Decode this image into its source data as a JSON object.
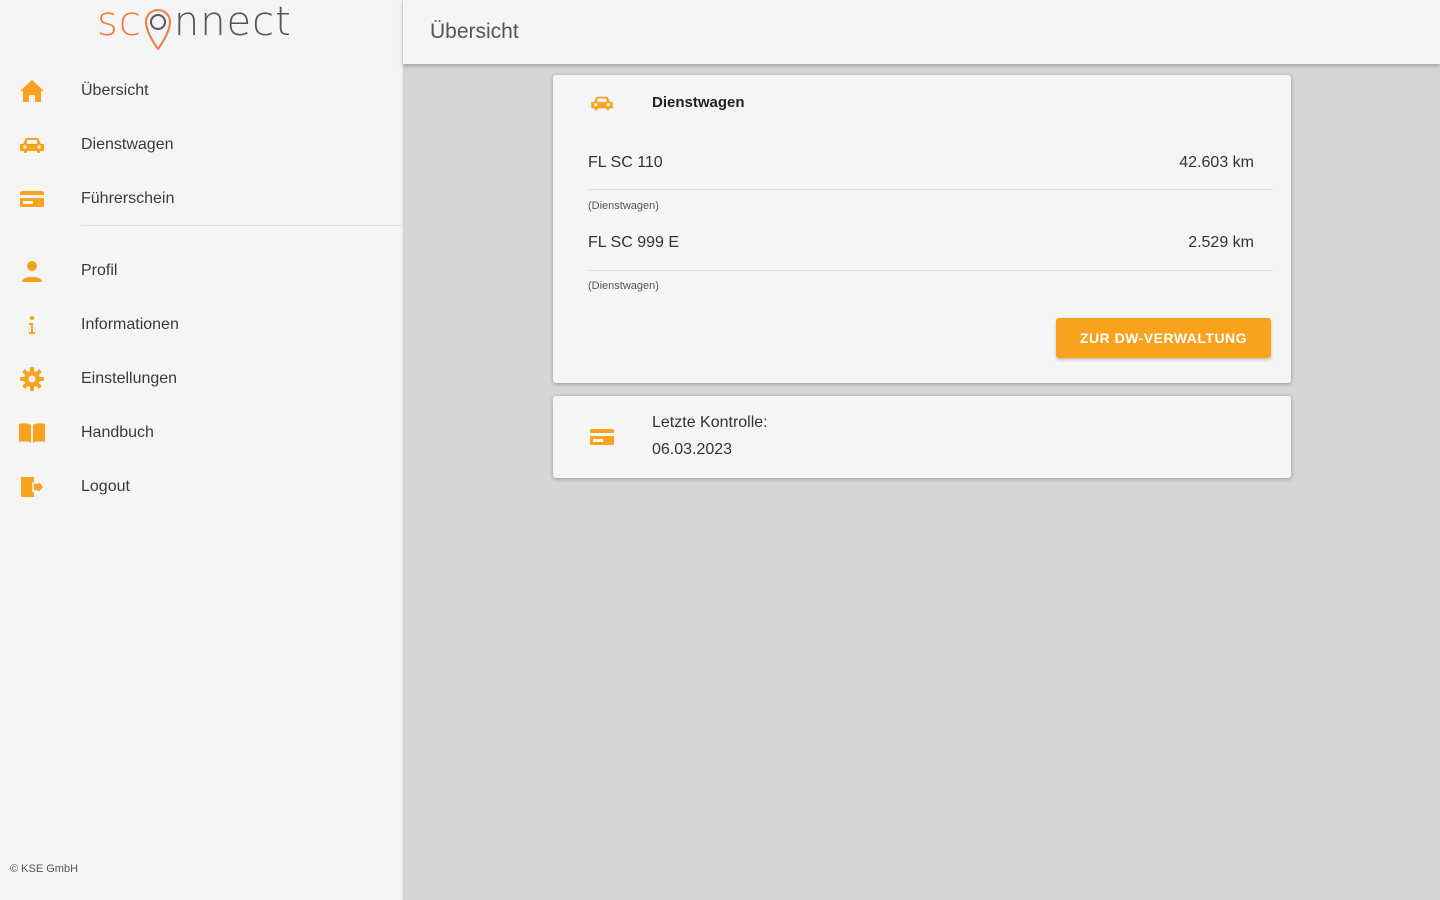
{
  "brand": {
    "logo_text_start": "sc",
    "logo_text_end": "nnect",
    "accent": "#f9a21d",
    "logo_accent": "#f47a3b"
  },
  "header": {
    "title": "Übersicht"
  },
  "sidebar": {
    "items": [
      {
        "label": "Übersicht",
        "icon": "home-icon"
      },
      {
        "label": "Dienstwagen",
        "icon": "car-icon"
      },
      {
        "label": "Führerschein",
        "icon": "license-card-icon"
      },
      {
        "label": "Profil",
        "icon": "person-icon"
      },
      {
        "label": "Informationen",
        "icon": "info-icon"
      },
      {
        "label": "Einstellungen",
        "icon": "gear-icon"
      },
      {
        "label": "Handbuch",
        "icon": "book-icon"
      },
      {
        "label": "Logout",
        "icon": "logout-icon"
      }
    ],
    "footer": "© KSE GmbH"
  },
  "cars_card": {
    "title": "Dienstwagen",
    "vehicles": [
      {
        "plate": "FL SC 110",
        "km": "42.603 km",
        "type": "(Dienstwagen)"
      },
      {
        "plate": "FL SC 999 E",
        "km": "2.529 km",
        "type": "(Dienstwagen)"
      }
    ],
    "button_label": "ZUR DW-VERWALTUNG"
  },
  "license_card": {
    "label": "Letzte Kontrolle:",
    "date": "06.03.2023"
  }
}
